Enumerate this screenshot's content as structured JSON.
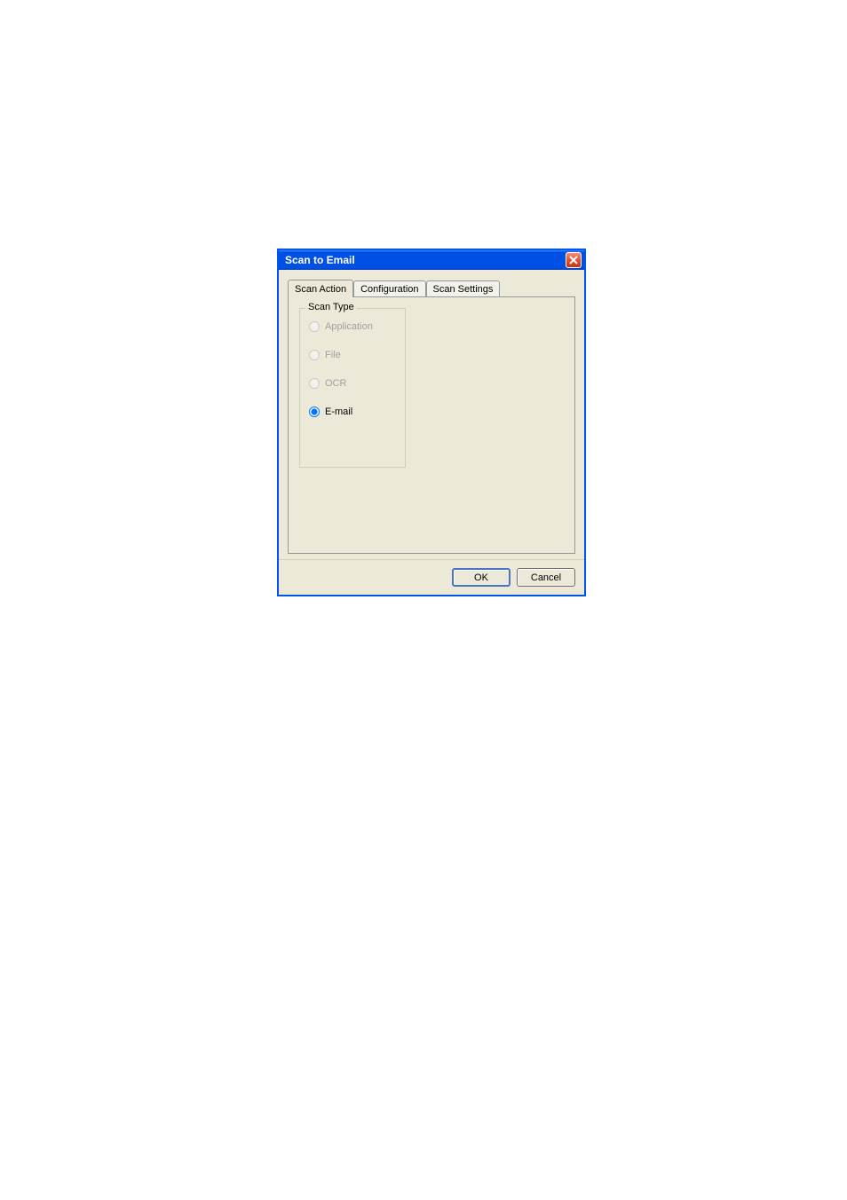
{
  "dialog": {
    "title": "Scan to Email",
    "tabs": [
      {
        "label": "Scan Action",
        "active": true
      },
      {
        "label": "Configuration",
        "active": false
      },
      {
        "label": "Scan Settings",
        "active": false
      }
    ],
    "fieldset": {
      "legend": "Scan Type",
      "options": [
        {
          "label": "Application",
          "selected": false,
          "disabled": true
        },
        {
          "label": "File",
          "selected": false,
          "disabled": true
        },
        {
          "label": "OCR",
          "selected": false,
          "disabled": true
        },
        {
          "label": "E-mail",
          "selected": true,
          "disabled": false
        }
      ]
    },
    "buttons": {
      "ok": "OK",
      "cancel": "Cancel"
    }
  }
}
